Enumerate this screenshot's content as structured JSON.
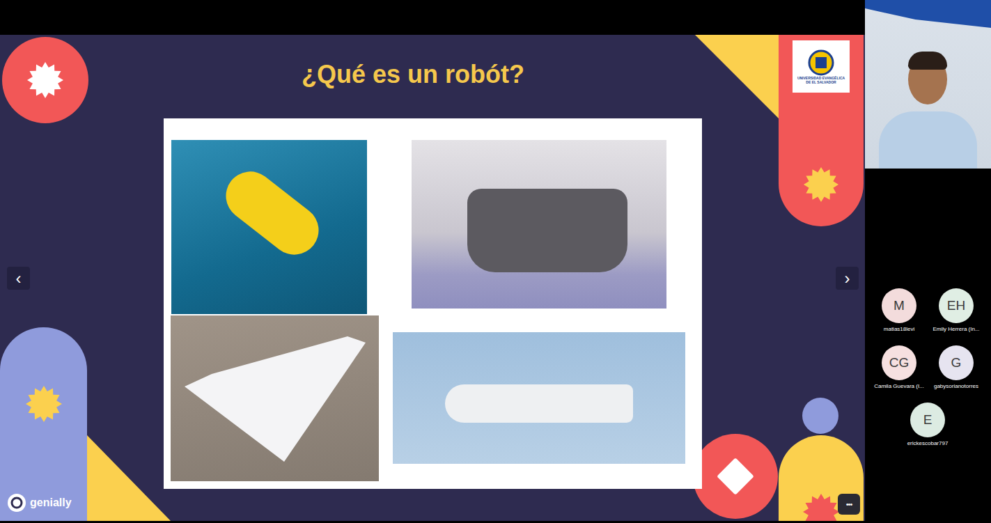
{
  "slide": {
    "title": "¿Qué es un robót?",
    "logo_text": "UNIVERSIDAD EVANGÉLICA DE EL SALVADOR",
    "prev": "‹",
    "next": "›",
    "brand": "genially"
  },
  "participants": [
    {
      "initials": "M",
      "name": "matias18levi",
      "color": "#f3dcdc"
    },
    {
      "initials": "EH",
      "name": "Emily Herrera (In...",
      "color": "#e0eee4"
    },
    {
      "initials": "CG",
      "name": "Camila Guevara (I...",
      "color": "#f6e0e0"
    },
    {
      "initials": "G",
      "name": "gabysorianotorres",
      "color": "#e6e4f0"
    },
    {
      "initials": "E",
      "name": "erickescobar797",
      "color": "#dcebe2"
    }
  ],
  "more_button": "•••"
}
